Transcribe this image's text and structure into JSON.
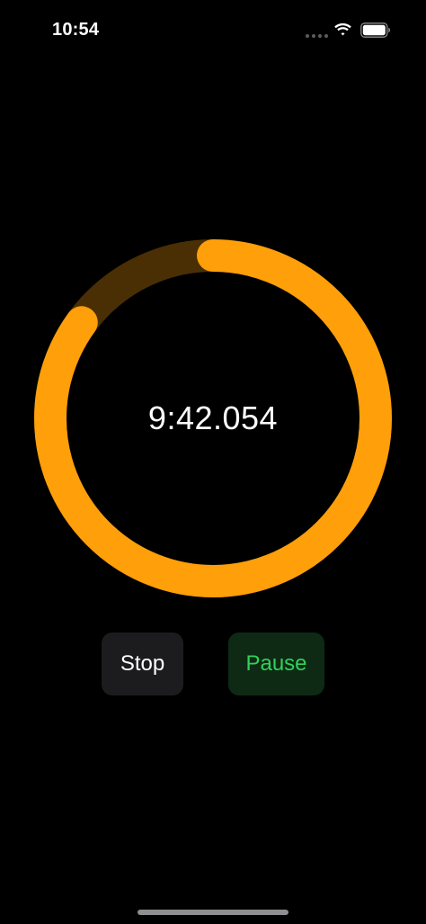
{
  "status_bar": {
    "time": "10:54",
    "icons": [
      "cellular-dots-icon",
      "wifi-icon",
      "battery-icon"
    ]
  },
  "timer": {
    "display": "9:42.054",
    "progress_remaining_fraction": 0.85
  },
  "buttons": {
    "stop_label": "Stop",
    "pause_label": "Pause"
  },
  "colors": {
    "background": "#000000",
    "ring_active": "#ff9f0a",
    "ring_track": "#4a2f05",
    "stop_bg": "#1c1c1e",
    "stop_text": "#ffffff",
    "pause_bg": "#0e2a15",
    "pause_text": "#30d158"
  }
}
